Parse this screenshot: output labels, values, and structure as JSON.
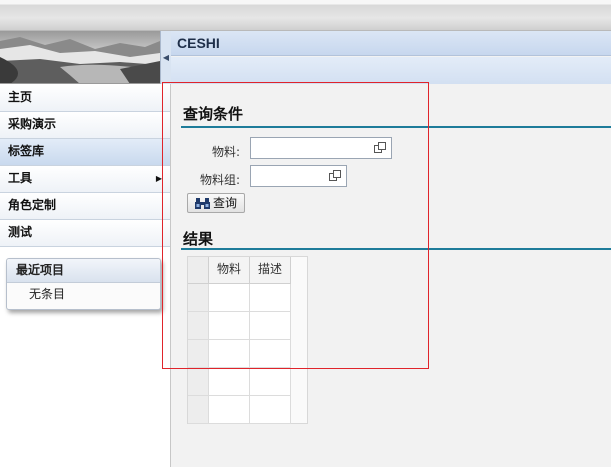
{
  "header": {
    "title": "CESHI"
  },
  "nav": {
    "items": [
      {
        "label": "主页"
      },
      {
        "label": "采购演示"
      },
      {
        "label": "标签库"
      },
      {
        "label": "工具"
      },
      {
        "label": "角色定制"
      },
      {
        "label": "测试"
      }
    ],
    "selected": "标签库"
  },
  "recent": {
    "title": "最近项目",
    "empty": "无条目"
  },
  "query": {
    "section_title": "查询条件",
    "fields": [
      {
        "label": "物料:",
        "value": ""
      },
      {
        "label": "物料组:",
        "value": ""
      }
    ],
    "button_label": "查询"
  },
  "results": {
    "section_title": "结果",
    "columns": [
      "物料",
      "描述"
    ],
    "rows": []
  },
  "colors": {
    "accent_line": "#1e7c9a",
    "header_blue": "#c7d7ee",
    "highlight_frame": "#e0242b"
  },
  "icons": [
    "binoculars-icon",
    "value-help-icon",
    "collapse-arrow-icon",
    "submenu-arrow-icon"
  ]
}
